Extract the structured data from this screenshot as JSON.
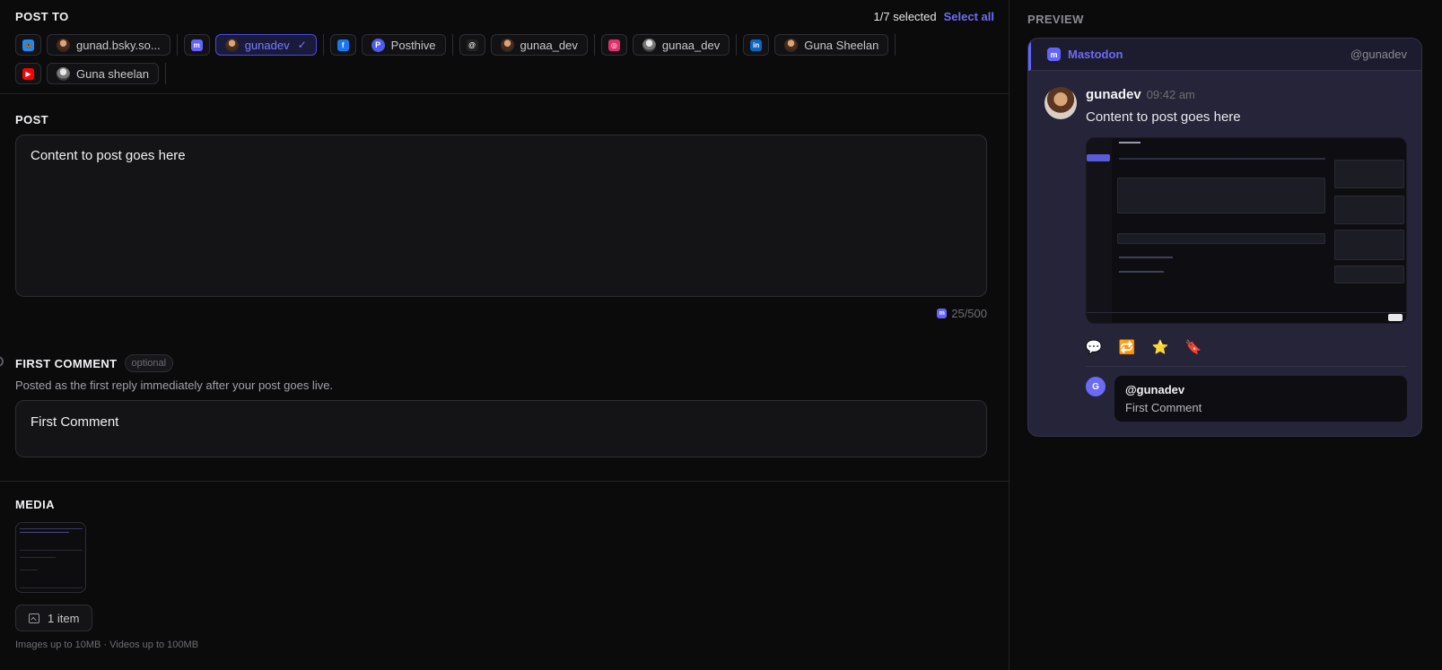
{
  "post_to": {
    "title": "POST TO",
    "selected": "1/7 selected",
    "select_all": "Select all",
    "groups": [
      {
        "network": "bluesky",
        "net_color": "#1a8cff",
        "net_glyph": "🦋",
        "accounts": [
          {
            "label": "gunad.bsky.so...",
            "avatar": "photo",
            "active": false
          }
        ]
      },
      {
        "network": "mastodon",
        "net_color": "#6364ff",
        "net_glyph": "m",
        "accounts": [
          {
            "label": "gunadev",
            "avatar": "photo",
            "active": true
          }
        ]
      },
      {
        "network": "facebook",
        "net_color": "#1877f2",
        "net_glyph": "f",
        "accounts": [
          {
            "label": "Posthive",
            "avatar": "ph",
            "active": false
          }
        ]
      },
      {
        "network": "threads",
        "net_color": "#222222",
        "net_glyph": "@",
        "accounts": [
          {
            "label": "gunaa_dev",
            "avatar": "photo",
            "active": false
          }
        ]
      },
      {
        "network": "instagram",
        "net_color": "#e1306c",
        "net_glyph": "◎",
        "accounts": [
          {
            "label": "gunaa_dev",
            "avatar": "gray",
            "active": false
          }
        ]
      },
      {
        "network": "linkedin",
        "net_color": "#0a66c2",
        "net_glyph": "in",
        "accounts": [
          {
            "label": "Guna Sheelan",
            "avatar": "photo",
            "active": false
          }
        ]
      },
      {
        "network": "youtube",
        "net_color": "#ff0000",
        "net_glyph": "▶",
        "accounts": [
          {
            "label": "Guna sheelan",
            "avatar": "gray",
            "active": false
          }
        ]
      }
    ]
  },
  "post": {
    "title": "POST",
    "content": "Content to post goes here",
    "char_count": "25/500"
  },
  "first_comment": {
    "title": "FIRST COMMENT",
    "badge": "optional",
    "subtitle": "Posted as the first reply immediately after your post goes live.",
    "content": "First Comment"
  },
  "media": {
    "title": "MEDIA",
    "items_label": "1 item",
    "limits": "Images up to 10MB · Videos up to 100MB"
  },
  "preview": {
    "title": "PREVIEW",
    "network": "Mastodon",
    "handle": "@gunadev",
    "username": "gunadev",
    "time": "09:42 am",
    "text": "Content to post goes here",
    "reply_avatar": "G",
    "reply_handle": "@gunadev",
    "reply_text": "First Comment"
  },
  "colors": {
    "accent": "#6364ff",
    "select_all": "#6b6cf5"
  }
}
